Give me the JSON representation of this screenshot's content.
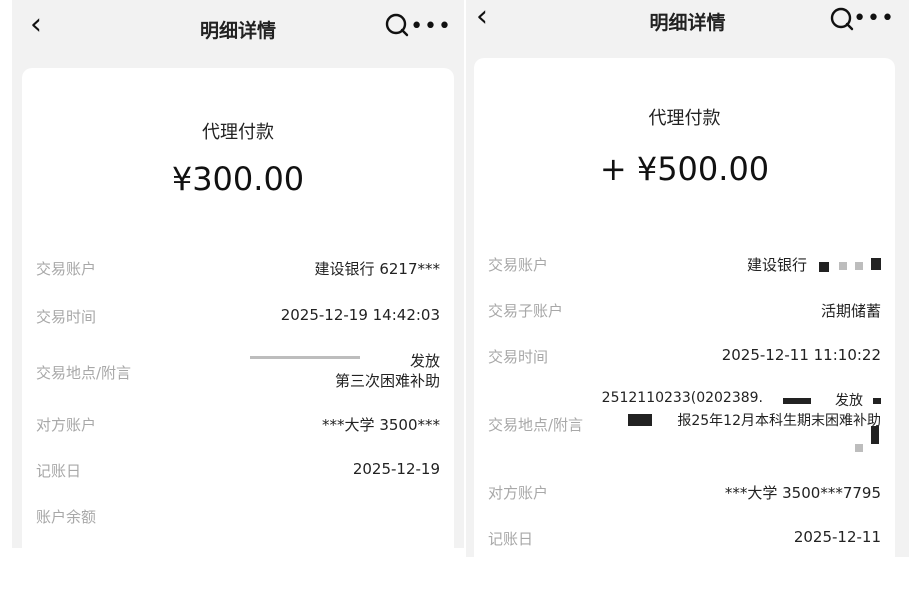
{
  "left": {
    "header": {
      "title": "明细详情"
    },
    "type": "代理付款",
    "amount": "¥300.00",
    "rows": [
      {
        "label": "交易账户",
        "value": "建设银行 6217***"
      },
      {
        "label": "交易时间",
        "value": "2025-12-19 14:42:03"
      },
      {
        "label": "交易地点/附言",
        "value": "发放",
        "value2": "第三次困难补助"
      },
      {
        "label": "对方账户",
        "value": "***大学 3500***"
      },
      {
        "label": "记账日",
        "value": "2025-12-19"
      },
      {
        "label": "账户余额",
        "value": ""
      }
    ]
  },
  "right": {
    "header": {
      "title": "明细详情"
    },
    "type": "代理付款",
    "amount": "+ ¥500.00",
    "rows": [
      {
        "label": "交易账户",
        "value": "建设银行"
      },
      {
        "label": "交易子账户",
        "value": "活期储蓄"
      },
      {
        "label": "交易时间",
        "value": "2025-12-11 11:10:22"
      },
      {
        "label": "交易地点/附言",
        "value": "2512110233(0202389.",
        "value_mid": "发放",
        "value2": "报25年12月本科生期末困难补助"
      },
      {
        "label": "对方账户",
        "value": "***大学 3500***7795"
      },
      {
        "label": "记账日",
        "value": "2025-12-11"
      }
    ]
  }
}
